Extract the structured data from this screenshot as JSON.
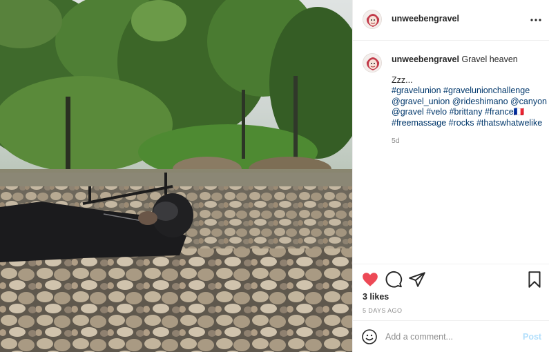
{
  "header": {
    "username": "unweebengravel",
    "more_icon": "more-horizontal-icon"
  },
  "caption": {
    "username": "unweebengravel",
    "text": "Gravel heaven",
    "line2": "Zzz...",
    "hashtags": [
      "#gravelunion #gravelunionchallenge",
      "@gravel_union @rideshimano @canyon",
      "@gravel #velo #brittany #france🇫🇷",
      "#freemassage #rocks #thatswhatwelike"
    ],
    "time": "5d"
  },
  "actions": {
    "like_icon": "heart-icon",
    "like_color": "#ed4956",
    "comment_icon": "comment-icon",
    "share_icon": "share-icon",
    "save_icon": "bookmark-icon",
    "likes": "3 likes",
    "date": "5 DAYS AGO"
  },
  "add_comment": {
    "emoji_icon": "emoji-icon",
    "placeholder": "Add a comment...",
    "post_label": "Post",
    "post_color": "#b2dffc"
  }
}
